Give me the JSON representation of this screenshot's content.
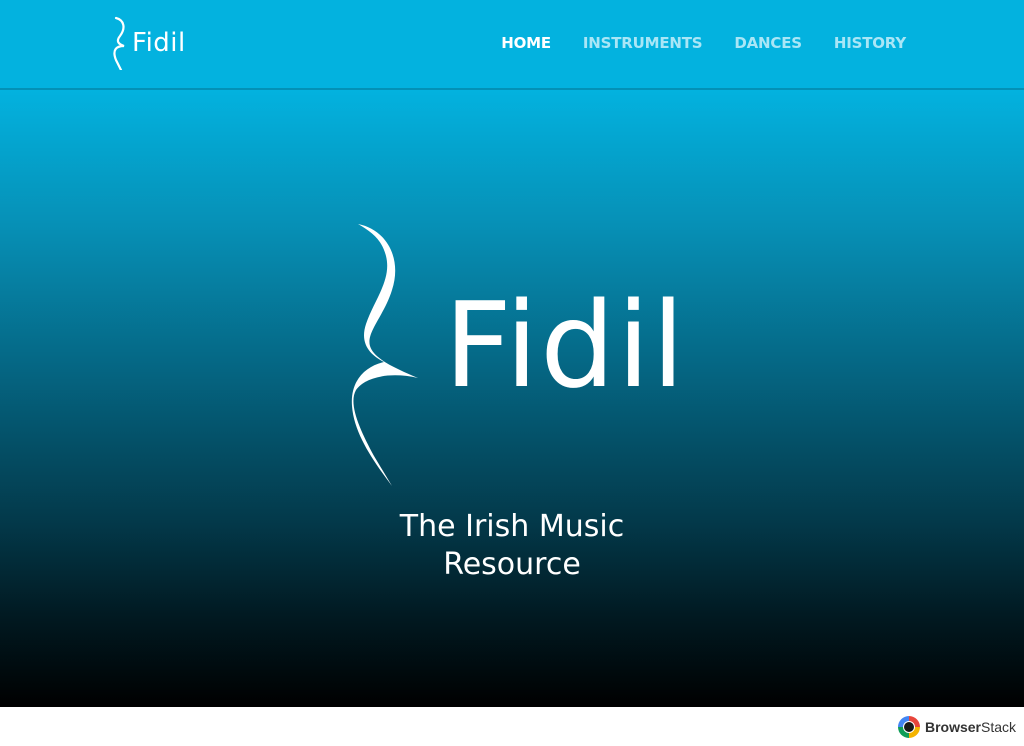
{
  "brand": {
    "name": "Fidil",
    "hero_name": "Fidil",
    "tagline_line1": "The Irish Music",
    "tagline_line2": "Resource"
  },
  "nav": {
    "items": [
      {
        "label": "HOME",
        "active": true
      },
      {
        "label": "INSTRUMENTS",
        "active": false
      },
      {
        "label": "DANCES",
        "active": false
      },
      {
        "label": "HISTORY",
        "active": false
      }
    ]
  },
  "colors": {
    "navbar": "#03b2df",
    "nav_active": "#ffffff",
    "nav_inactive": "#a9e6f6",
    "hero_top": "#03b2df",
    "hero_bottom": "#000000"
  },
  "watermark": {
    "label_bold": "Browser",
    "label_regular": "Stack"
  }
}
